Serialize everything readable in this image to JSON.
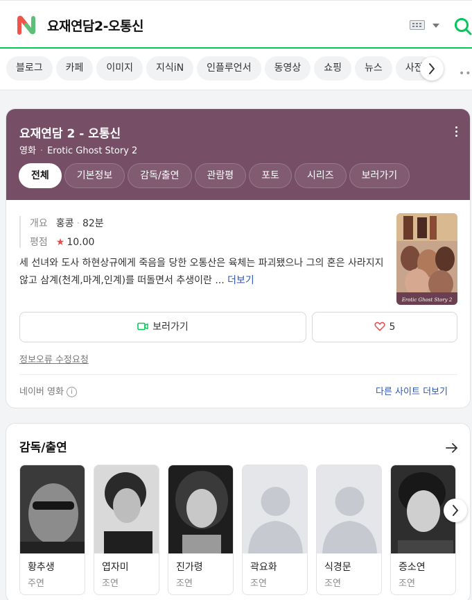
{
  "header": {
    "query": "요재연담2-오통신",
    "logo_icon": "naver-n-logo",
    "brand_colors": {
      "green": "#03c75a",
      "logo_red": "#f0534a",
      "logo_green": "#5dbf78"
    }
  },
  "tabs": [
    "블로그",
    "카페",
    "이미지",
    "지식iN",
    "인플루언서",
    "동영상",
    "쇼핑",
    "뉴스",
    "사전"
  ],
  "movie": {
    "title": "요재연담 2 - 오통신",
    "category": "영화",
    "original_title": "Erotic Ghost Story 2",
    "header_color": "#764e66",
    "subtabs": [
      "전체",
      "기본정보",
      "감독/출연",
      "관람평",
      "포토",
      "시리즈",
      "보러가기"
    ],
    "active_subtab": "전체",
    "overview_label": "개요",
    "country": "홍콩",
    "runtime": "82분",
    "rating_label": "평점",
    "rating_star": "★",
    "rating": "10.00",
    "synopsis": "세 선녀와 도사 하현상규에게 죽음을 당한 오통산은 육체는 파괴됐으나 그의 혼은 사라지지 않고 삼계(천계,마계,인계)를 떠돌면서 추생이란 ...",
    "more_label": "더보기",
    "poster_caption": "Erotic Ghost Story 2",
    "watch_label": "보러가기",
    "like_count": "5",
    "report_label": "정보오류 수정요청",
    "source_label": "네이버 영화",
    "info_icon": "i",
    "other_sites_label": "다른 사이트 더보기"
  },
  "cast": {
    "title": "감독/출연",
    "people": [
      {
        "name": "황추생",
        "role": "주연"
      },
      {
        "name": "엽자미",
        "role": "조연"
      },
      {
        "name": "진가령",
        "role": "조연"
      },
      {
        "name": "곽요화",
        "role": "조연"
      },
      {
        "name": "식경문",
        "role": "조연"
      },
      {
        "name": "증소연",
        "role": "조연"
      }
    ]
  }
}
